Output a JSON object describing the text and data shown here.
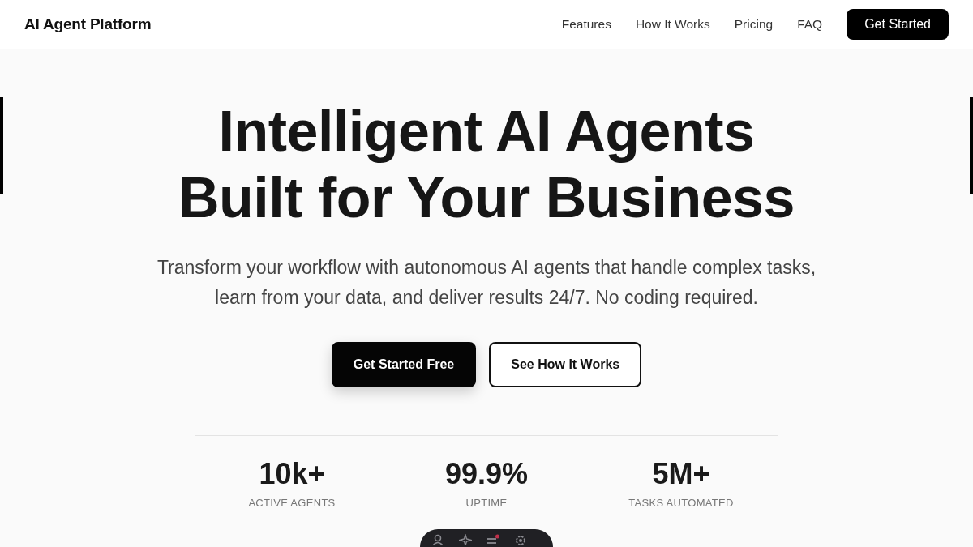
{
  "navbar": {
    "brand": "AI Agent Platform",
    "links": [
      {
        "label": "Features"
      },
      {
        "label": "How It Works"
      },
      {
        "label": "Pricing"
      },
      {
        "label": "FAQ"
      }
    ],
    "cta": "Get Started"
  },
  "hero": {
    "headline": [
      "Intelligent AI Agents",
      "Built for Your Business"
    ],
    "subtitle": "Transform your workflow with autonomous AI agents that handle complex tasks, learn from your data, and deliver results 24/7. No coding required.",
    "buttons": [
      {
        "label": "Get Started Free",
        "kind": "primary"
      },
      {
        "label": "See How It Works",
        "kind": "outline"
      }
    ]
  },
  "stats": [
    {
      "value": "10k+",
      "label": "ACTIVE AGENTS"
    },
    {
      "value": "99.9%",
      "label": "UPTIME"
    },
    {
      "value": "5M+",
      "label": "TASKS AUTOMATED"
    }
  ]
}
